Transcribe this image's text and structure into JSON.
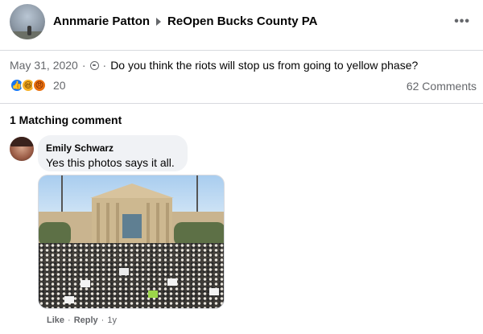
{
  "header": {
    "author": "Annmarie Patton",
    "group": "ReOpen Bucks County PA",
    "more_icon": "ellipsis-icon"
  },
  "post": {
    "date": "May 31, 2020",
    "separator1": "·",
    "privacy_icon": "globe-icon",
    "separator2": "·",
    "text": "Do you think the riots will stop us from going to yellow phase?"
  },
  "reactions": {
    "icons": [
      "like-icon",
      "haha-icon",
      "angry-icon"
    ],
    "count": "20",
    "comments": "62 Comments"
  },
  "matching": {
    "label": "1 Matching comment"
  },
  "comment": {
    "author": "Emily Schwarz",
    "text": "Yes this photos says it all.",
    "photo": "crowd-photo",
    "actions": {
      "like": "Like",
      "dot1": "·",
      "reply": "Reply",
      "dot2": "·",
      "time": "1y"
    }
  },
  "colors": {
    "brand": "#1877f2",
    "secondary_text": "#65676b",
    "bubble": "#f0f2f5"
  }
}
